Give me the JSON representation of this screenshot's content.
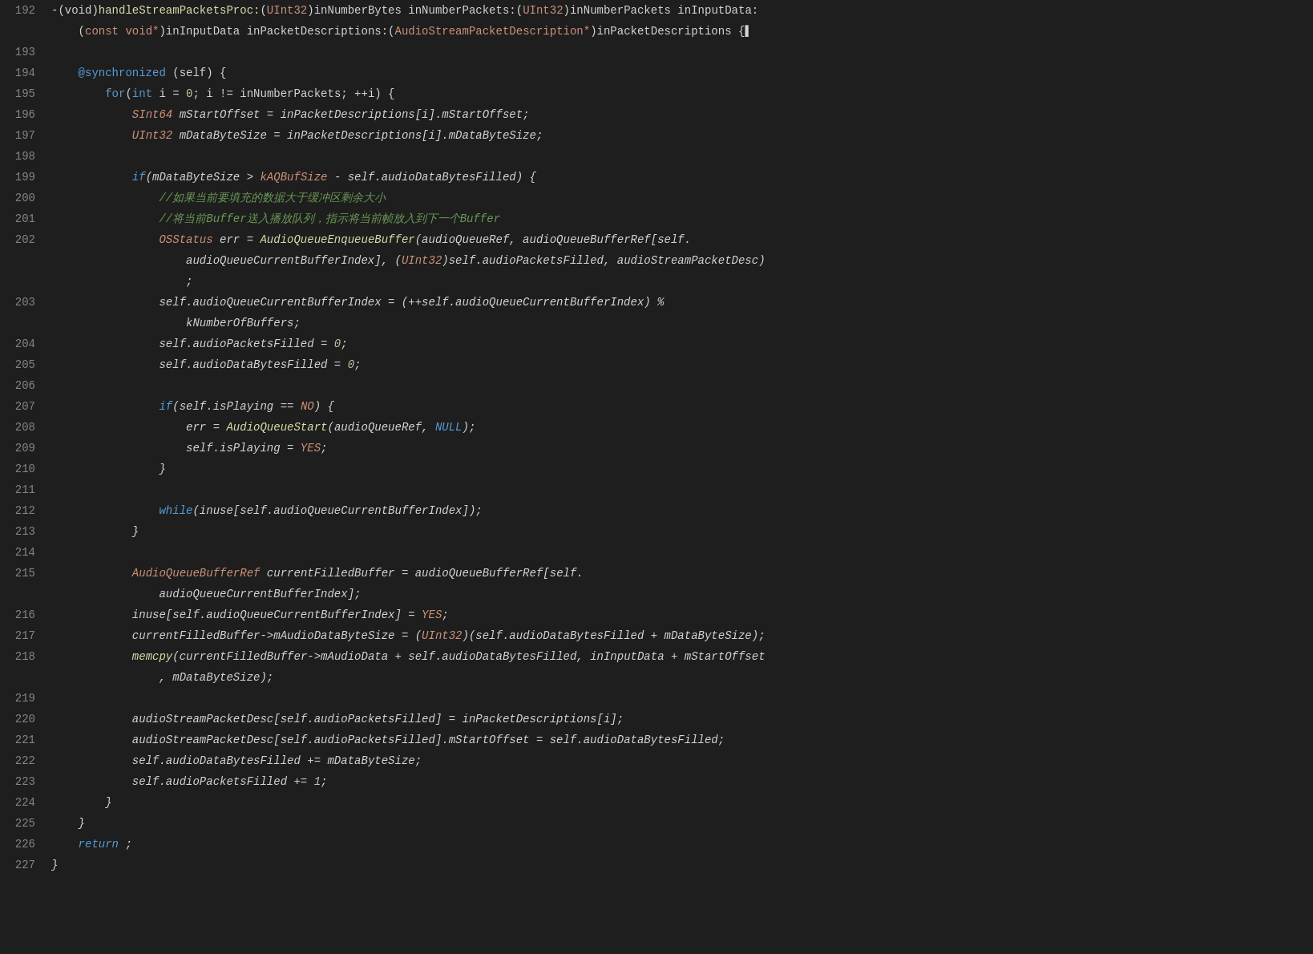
{
  "editor": {
    "lines": [
      {
        "num": "192",
        "tokens": [
          {
            "t": "-(void)",
            "c": "c-white"
          },
          {
            "t": "handleStreamPacketsProc:",
            "c": "c-yellow"
          },
          {
            "t": "(",
            "c": "c-white"
          },
          {
            "t": "UInt32",
            "c": "c-orange"
          },
          {
            "t": ")inNumberBytes inNumberPackets:(",
            "c": "c-white"
          },
          {
            "t": "UInt32",
            "c": "c-orange"
          },
          {
            "t": ")inNumberPackets inInputData:",
            "c": "c-white"
          }
        ]
      },
      {
        "num": "",
        "tokens": [
          {
            "t": "    (",
            "c": "c-white"
          },
          {
            "t": "const void*",
            "c": "c-orange"
          },
          {
            "t": ")inInputData inPacketDescriptions:(",
            "c": "c-white"
          },
          {
            "t": "AudioStreamPacketDescription*",
            "c": "c-orange"
          },
          {
            "t": ")inPacketDescriptions {",
            "c": "c-white"
          },
          {
            "t": "▌",
            "c": "c-white"
          }
        ]
      },
      {
        "num": "193",
        "tokens": []
      },
      {
        "num": "194",
        "tokens": [
          {
            "t": "    ",
            "c": "c-white"
          },
          {
            "t": "@synchronized",
            "c": "c-blue"
          },
          {
            "t": " (self) {",
            "c": "c-white"
          }
        ]
      },
      {
        "num": "195",
        "tokens": [
          {
            "t": "        ",
            "c": "c-white"
          },
          {
            "t": "for",
            "c": "c-blue"
          },
          {
            "t": "(",
            "c": "c-white"
          },
          {
            "t": "int",
            "c": "c-blue"
          },
          {
            "t": " i = ",
            "c": "c-white"
          },
          {
            "t": "0",
            "c": "c-number"
          },
          {
            "t": "; i != inNumberPackets; ++i) {",
            "c": "c-white"
          }
        ]
      },
      {
        "num": "196",
        "tokens": [
          {
            "t": "            ",
            "c": "c-white"
          },
          {
            "t": "SInt64",
            "c": "c-orange c-italic"
          },
          {
            "t": " mStartOffset = inPacketDescriptions[i].mStartOffset;",
            "c": "c-white c-italic"
          }
        ]
      },
      {
        "num": "197",
        "tokens": [
          {
            "t": "            ",
            "c": "c-white"
          },
          {
            "t": "UInt32",
            "c": "c-orange c-italic"
          },
          {
            "t": " mDataByteSize = inPacketDescriptions[i].mDataByteSize;",
            "c": "c-white c-italic"
          }
        ]
      },
      {
        "num": "198",
        "tokens": []
      },
      {
        "num": "199",
        "tokens": [
          {
            "t": "            ",
            "c": "c-white"
          },
          {
            "t": "if",
            "c": "c-blue c-italic"
          },
          {
            "t": "(mDataByteSize > ",
            "c": "c-white c-italic"
          },
          {
            "t": "kAQBufSize",
            "c": "c-orange c-italic"
          },
          {
            "t": " - self.audioDataBytesFilled) {",
            "c": "c-white c-italic"
          }
        ]
      },
      {
        "num": "200",
        "tokens": [
          {
            "t": "                ",
            "c": "c-white"
          },
          {
            "t": "//如果当前要填充的数据大于缓冲区剩余大小",
            "c": "c-comment c-italic"
          }
        ]
      },
      {
        "num": "201",
        "tokens": [
          {
            "t": "                ",
            "c": "c-white"
          },
          {
            "t": "//将当前",
            "c": "c-comment c-italic"
          },
          {
            "t": "Buffer",
            "c": "c-comment c-italic"
          },
          {
            "t": "送入播放队列，指示将当前帧放入到下一个",
            "c": "c-comment c-italic"
          },
          {
            "t": "Buffer",
            "c": "c-comment c-italic"
          }
        ]
      },
      {
        "num": "202",
        "tokens": [
          {
            "t": "                ",
            "c": "c-white"
          },
          {
            "t": "OSStatus",
            "c": "c-orange c-italic"
          },
          {
            "t": " err = ",
            "c": "c-white c-italic"
          },
          {
            "t": "AudioQueueEnqueueBuffer",
            "c": "c-yellow c-italic"
          },
          {
            "t": "(audioQueueRef, audioQueueBufferRef[self.",
            "c": "c-white c-italic"
          }
        ]
      },
      {
        "num": "",
        "tokens": [
          {
            "t": "                    audioQueueCurrentBufferIndex], (",
            "c": "c-white c-italic"
          },
          {
            "t": "UInt32",
            "c": "c-orange c-italic"
          },
          {
            "t": ")self.audioPacketsFilled, audioStreamPacketDesc)",
            "c": "c-white c-italic"
          }
        ]
      },
      {
        "num": "",
        "tokens": [
          {
            "t": "                    ;",
            "c": "c-white c-italic"
          }
        ]
      },
      {
        "num": "203",
        "tokens": [
          {
            "t": "                ",
            "c": "c-white"
          },
          {
            "t": "self.audioQueueCurrentBufferIndex = (++self.audioQueueCurrentBufferIndex) %",
            "c": "c-white c-italic"
          }
        ]
      },
      {
        "num": "",
        "tokens": [
          {
            "t": "                    kNumberOfBuffers;",
            "c": "c-white c-italic"
          }
        ]
      },
      {
        "num": "204",
        "tokens": [
          {
            "t": "                ",
            "c": "c-white"
          },
          {
            "t": "self.audioPacketsFilled = ",
            "c": "c-white c-italic"
          },
          {
            "t": "0",
            "c": "c-number c-italic"
          },
          {
            "t": ";",
            "c": "c-white c-italic"
          }
        ]
      },
      {
        "num": "205",
        "tokens": [
          {
            "t": "                ",
            "c": "c-white"
          },
          {
            "t": "self.audioDataBytesFilled = ",
            "c": "c-white c-italic"
          },
          {
            "t": "0",
            "c": "c-number c-italic"
          },
          {
            "t": ";",
            "c": "c-white c-italic"
          }
        ]
      },
      {
        "num": "206",
        "tokens": []
      },
      {
        "num": "207",
        "tokens": [
          {
            "t": "                ",
            "c": "c-white"
          },
          {
            "t": "if",
            "c": "c-blue c-italic"
          },
          {
            "t": "(self.isPlaying == ",
            "c": "c-white c-italic"
          },
          {
            "t": "NO",
            "c": "c-orange c-italic"
          },
          {
            "t": ") {",
            "c": "c-white c-italic"
          }
        ]
      },
      {
        "num": "208",
        "tokens": [
          {
            "t": "                    ",
            "c": "c-white"
          },
          {
            "t": "err = ",
            "c": "c-white c-italic"
          },
          {
            "t": "AudioQueueStart",
            "c": "c-yellow c-italic"
          },
          {
            "t": "(audioQueueRef, ",
            "c": "c-white c-italic"
          },
          {
            "t": "NULL",
            "c": "c-blue c-italic"
          },
          {
            "t": ");",
            "c": "c-white c-italic"
          }
        ]
      },
      {
        "num": "209",
        "tokens": [
          {
            "t": "                    ",
            "c": "c-white"
          },
          {
            "t": "self.isPlaying = ",
            "c": "c-white c-italic"
          },
          {
            "t": "YES",
            "c": "c-orange c-italic"
          },
          {
            "t": ";",
            "c": "c-white c-italic"
          }
        ]
      },
      {
        "num": "210",
        "tokens": [
          {
            "t": "                }",
            "c": "c-white c-italic"
          }
        ]
      },
      {
        "num": "211",
        "tokens": []
      },
      {
        "num": "212",
        "tokens": [
          {
            "t": "                ",
            "c": "c-white"
          },
          {
            "t": "while",
            "c": "c-blue c-italic"
          },
          {
            "t": "(inuse[self.audioQueueCurrentBufferIndex]);",
            "c": "c-white c-italic"
          }
        ]
      },
      {
        "num": "213",
        "tokens": [
          {
            "t": "            }",
            "c": "c-white c-italic"
          }
        ]
      },
      {
        "num": "214",
        "tokens": []
      },
      {
        "num": "215",
        "tokens": [
          {
            "t": "            ",
            "c": "c-white"
          },
          {
            "t": "AudioQueueBufferRef",
            "c": "c-orange c-italic"
          },
          {
            "t": " currentFilledBuffer = audioQueueBufferRef[self.",
            "c": "c-white c-italic"
          }
        ]
      },
      {
        "num": "",
        "tokens": [
          {
            "t": "                audioQueueCurrentBufferIndex];",
            "c": "c-white c-italic"
          }
        ]
      },
      {
        "num": "216",
        "tokens": [
          {
            "t": "            ",
            "c": "c-white"
          },
          {
            "t": "inuse[self.audioQueueCurrentBufferIndex] = ",
            "c": "c-white c-italic"
          },
          {
            "t": "YES",
            "c": "c-orange c-italic"
          },
          {
            "t": ";",
            "c": "c-white c-italic"
          }
        ]
      },
      {
        "num": "217",
        "tokens": [
          {
            "t": "            ",
            "c": "c-white"
          },
          {
            "t": "currentFilledBuffer->mAudioDataByteSize = (",
            "c": "c-white c-italic"
          },
          {
            "t": "UInt32",
            "c": "c-orange c-italic"
          },
          {
            "t": ")(self.audioDataBytesFilled + mDataByteSize);",
            "c": "c-white c-italic"
          }
        ]
      },
      {
        "num": "218",
        "tokens": [
          {
            "t": "            ",
            "c": "c-white"
          },
          {
            "t": "memcpy",
            "c": "c-yellow c-italic"
          },
          {
            "t": "(currentFilledBuffer->mAudioData + self.audioDataBytesFilled, inInputData + mStartOffset",
            "c": "c-white c-italic"
          }
        ]
      },
      {
        "num": "",
        "tokens": [
          {
            "t": "                , mDataByteSize);",
            "c": "c-white c-italic"
          }
        ]
      },
      {
        "num": "219",
        "tokens": []
      },
      {
        "num": "220",
        "tokens": [
          {
            "t": "            ",
            "c": "c-white"
          },
          {
            "t": "audioStreamPacketDesc[self.audioPacketsFilled] = inPacketDescriptions[i];",
            "c": "c-white c-italic"
          }
        ]
      },
      {
        "num": "221",
        "tokens": [
          {
            "t": "            ",
            "c": "c-white"
          },
          {
            "t": "audioStreamPacketDesc[self.audioPacketsFilled].mStartOffset = self.audioDataBytesFilled;",
            "c": "c-white c-italic"
          }
        ]
      },
      {
        "num": "222",
        "tokens": [
          {
            "t": "            ",
            "c": "c-white"
          },
          {
            "t": "self.audioDataBytesFilled += mDataByteSize;",
            "c": "c-white c-italic"
          }
        ]
      },
      {
        "num": "223",
        "tokens": [
          {
            "t": "            ",
            "c": "c-white"
          },
          {
            "t": "self.audioPacketsFilled += ",
            "c": "c-white c-italic"
          },
          {
            "t": "1",
            "c": "c-number c-italic"
          },
          {
            "t": ";",
            "c": "c-white c-italic"
          }
        ]
      },
      {
        "num": "224",
        "tokens": [
          {
            "t": "        }",
            "c": "c-white c-italic"
          }
        ]
      },
      {
        "num": "225",
        "tokens": [
          {
            "t": "    }",
            "c": "c-white c-italic"
          }
        ]
      },
      {
        "num": "226",
        "tokens": [
          {
            "t": "    ",
            "c": "c-white"
          },
          {
            "t": "return",
            "c": "c-blue c-italic"
          },
          {
            "t": " ;",
            "c": "c-white c-italic"
          }
        ]
      },
      {
        "num": "227",
        "tokens": [
          {
            "t": "}",
            "c": "c-white c-italic"
          }
        ]
      }
    ]
  }
}
